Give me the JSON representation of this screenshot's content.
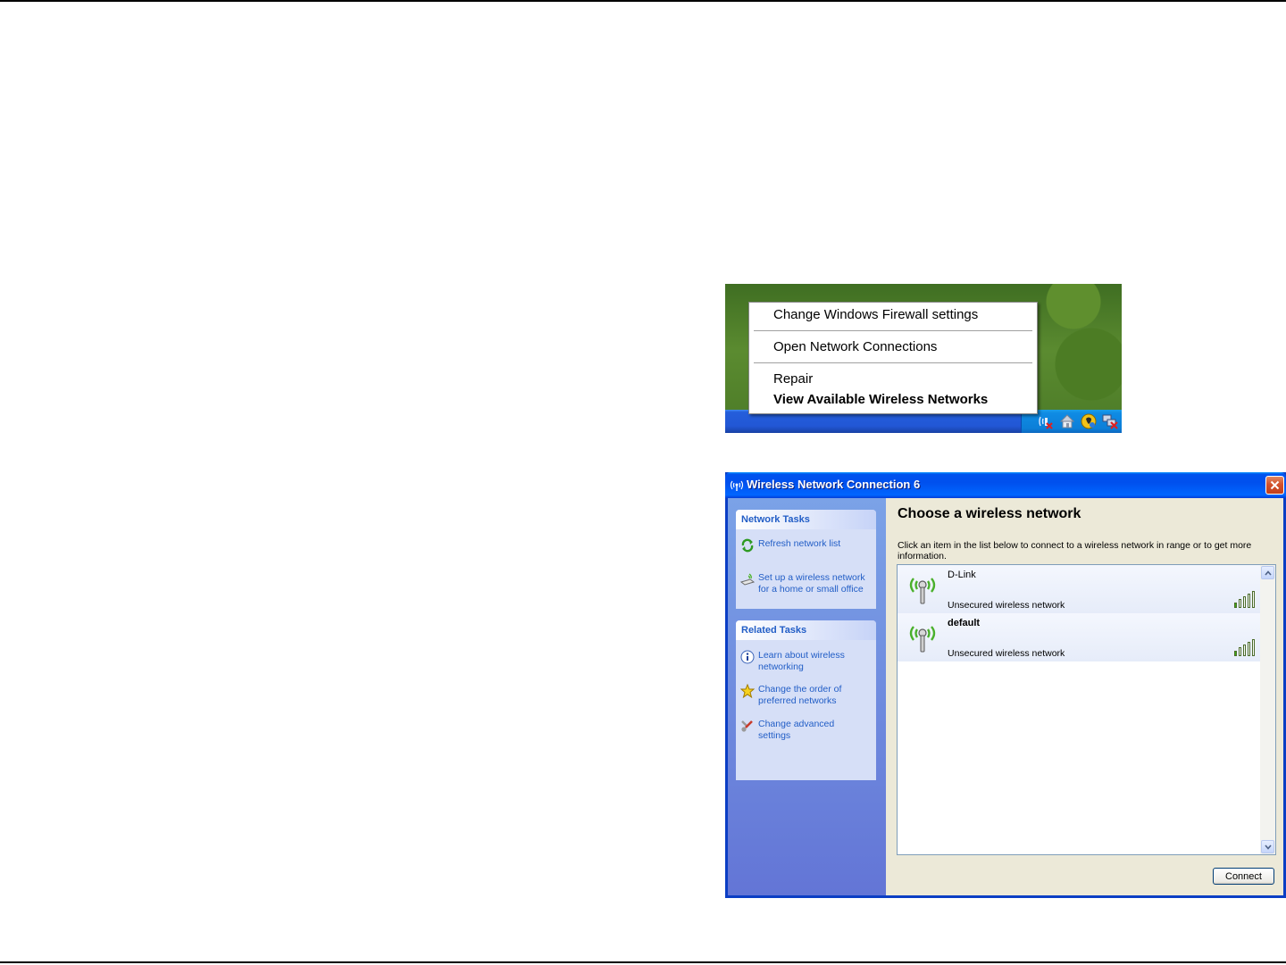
{
  "tray_menu": {
    "items": [
      {
        "label": "Change Windows Firewall settings",
        "bold": false
      },
      {
        "label": "Open Network Connections",
        "bold": false
      },
      {
        "label": "Repair",
        "bold": false
      },
      {
        "label": "View Available Wireless Networks",
        "bold": true
      }
    ],
    "tray_icons": [
      "wireless-disconnected-icon",
      "home-icon",
      "security-shield-icon",
      "network-disconnected-icon"
    ]
  },
  "window": {
    "title": "Wireless Network Connection 6",
    "title_icon": "wireless-antenna-icon",
    "sidebar": {
      "network_tasks": {
        "heading": "Network Tasks",
        "items": [
          {
            "icon": "refresh-icon",
            "label": "Refresh network list"
          },
          {
            "icon": "setup-wireless-icon",
            "label": "Set up a wireless network for a home or small office"
          }
        ]
      },
      "related_tasks": {
        "heading": "Related Tasks",
        "items": [
          {
            "icon": "info-icon",
            "label": "Learn about wireless networking"
          },
          {
            "icon": "star-icon",
            "label": "Change the order of preferred networks"
          },
          {
            "icon": "settings-icon",
            "label": "Change advanced settings"
          }
        ]
      }
    },
    "main": {
      "heading": "Choose a wireless network",
      "description": "Click an item in the list below to connect to a wireless network in range or to get more information.",
      "networks": [
        {
          "name": "D-Link",
          "status": "Unsecured wireless network",
          "signal_bars": 1
        },
        {
          "name": "default",
          "status": "Unsecured wireless network",
          "signal_bars": 1
        }
      ],
      "connect_label": "Connect"
    }
  },
  "colors": {
    "xp_title_blue": "#0053ee",
    "task_link_blue": "#215dc6",
    "signal_green": "#3cae12",
    "antenna_green": "#49b02a"
  }
}
